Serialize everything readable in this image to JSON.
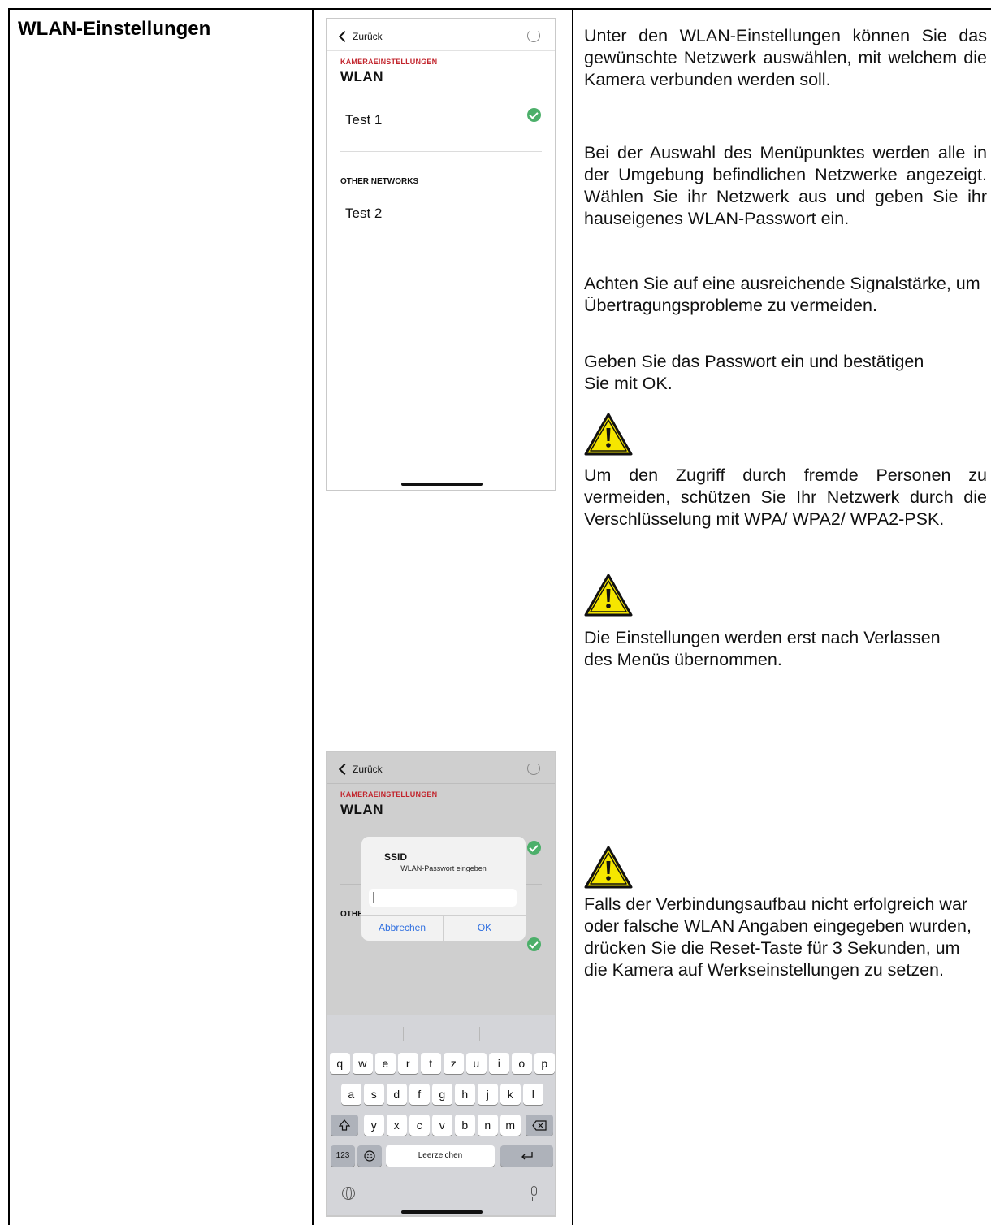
{
  "section_title": "WLAN-Einstellungen",
  "phone": {
    "back_label": "Zurück",
    "breadcrumb": "KAMERAEINSTELLUNGEN",
    "title": "WLAN",
    "network_1": "Test 1",
    "other_networks_label": "OTHER NETWORKS",
    "network_2": "Test 2"
  },
  "dialog": {
    "title": "SSID",
    "subtitle": "WLAN-Passwort eingeben",
    "cancel": "Abbrechen",
    "ok": "OK",
    "other_label_truncated": "OTHE"
  },
  "keyboard": {
    "row1": [
      "q",
      "w",
      "e",
      "r",
      "t",
      "z",
      "u",
      "i",
      "o",
      "p"
    ],
    "row2": [
      "a",
      "s",
      "d",
      "f",
      "g",
      "h",
      "j",
      "k",
      "l"
    ],
    "row3": [
      "y",
      "x",
      "c",
      "v",
      "b",
      "n",
      "m"
    ],
    "numbers": "123",
    "space": "Leerzeichen",
    "icons": [
      "shift-icon",
      "backspace-icon",
      "emoji-icon",
      "return-icon",
      "globe-icon",
      "microphone-icon"
    ]
  },
  "paragraphs": {
    "p1": "Unter den WLAN-Einstellungen können Sie das gewünschte Netzwerk auswählen, mit welchem die Kamera verbunden werden soll.",
    "p2": "Bei der Auswahl des Menüpunktes werden alle in der Umgebung befindlichen Netzwerke angezeigt. Wählen Sie ihr Netzwerk aus und geben Sie ihr hauseigenes WLAN-Passwort ein.",
    "p3": "Achten Sie auf eine ausreichende Signalstärke, um Übertragungsprobleme zu vermeiden.",
    "p4": "Geben Sie das Passwort ein und bestätigen Sie mit OK.",
    "p5": "Um den Zugriff durch fremde Personen zu vermeiden, schützen Sie Ihr Netzwerk durch die Verschlüsselung mit WPA/ WPA2/ WPA2-PSK.",
    "p6": "Die Einstellungen werden erst nach Verlassen des Menüs übernommen.",
    "p7": "Falls der Verbindungsaufbau nicht erfolgreich war oder falsche WLAN Angaben eingegeben wurden, drücken Sie die Reset-Taste für 3 Sekunden, um die Kamera auf Werkseinstellungen zu setzen."
  },
  "colors": {
    "accent_red": "#c2252d",
    "check_green": "#4caf6a",
    "warning_yellow": "#f5e600",
    "link_blue": "#2f6fe0"
  }
}
